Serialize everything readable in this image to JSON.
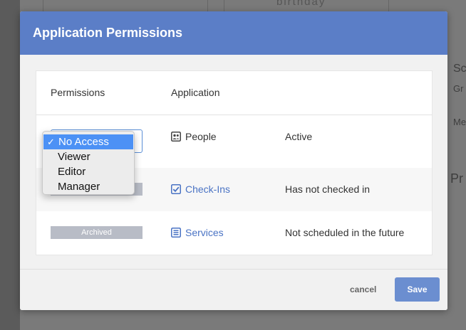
{
  "background": {
    "birthday_text": "birthday",
    "side_labels": [
      "Sc",
      "Gr",
      "Me",
      "Pr"
    ]
  },
  "modal": {
    "title": "Application Permissions",
    "columns": [
      "Permissions",
      "Application"
    ],
    "rows": [
      {
        "permission": "No Access",
        "app": "People",
        "icon": "people-icon",
        "status": "Active",
        "linked": false
      },
      {
        "permission": "",
        "app": "Check-Ins",
        "icon": "checkbox-icon",
        "status": "Has not checked in",
        "linked": true
      },
      {
        "permission": "Archived",
        "app": "Services",
        "icon": "list-icon",
        "status": "Not scheduled in the future",
        "linked": true
      }
    ],
    "dropdown": {
      "options": [
        "No Access",
        "Viewer",
        "Editor",
        "Manager"
      ],
      "selected": "No Access",
      "check": "✓"
    },
    "footer": {
      "cancel_label": "cancel",
      "save_label": "Save"
    }
  },
  "colors": {
    "header": "#5b7ec7",
    "link": "#4a73c4",
    "save": "#6b8ed0",
    "selected_option": "#4c91f5",
    "badge": "#b8bcc6"
  }
}
